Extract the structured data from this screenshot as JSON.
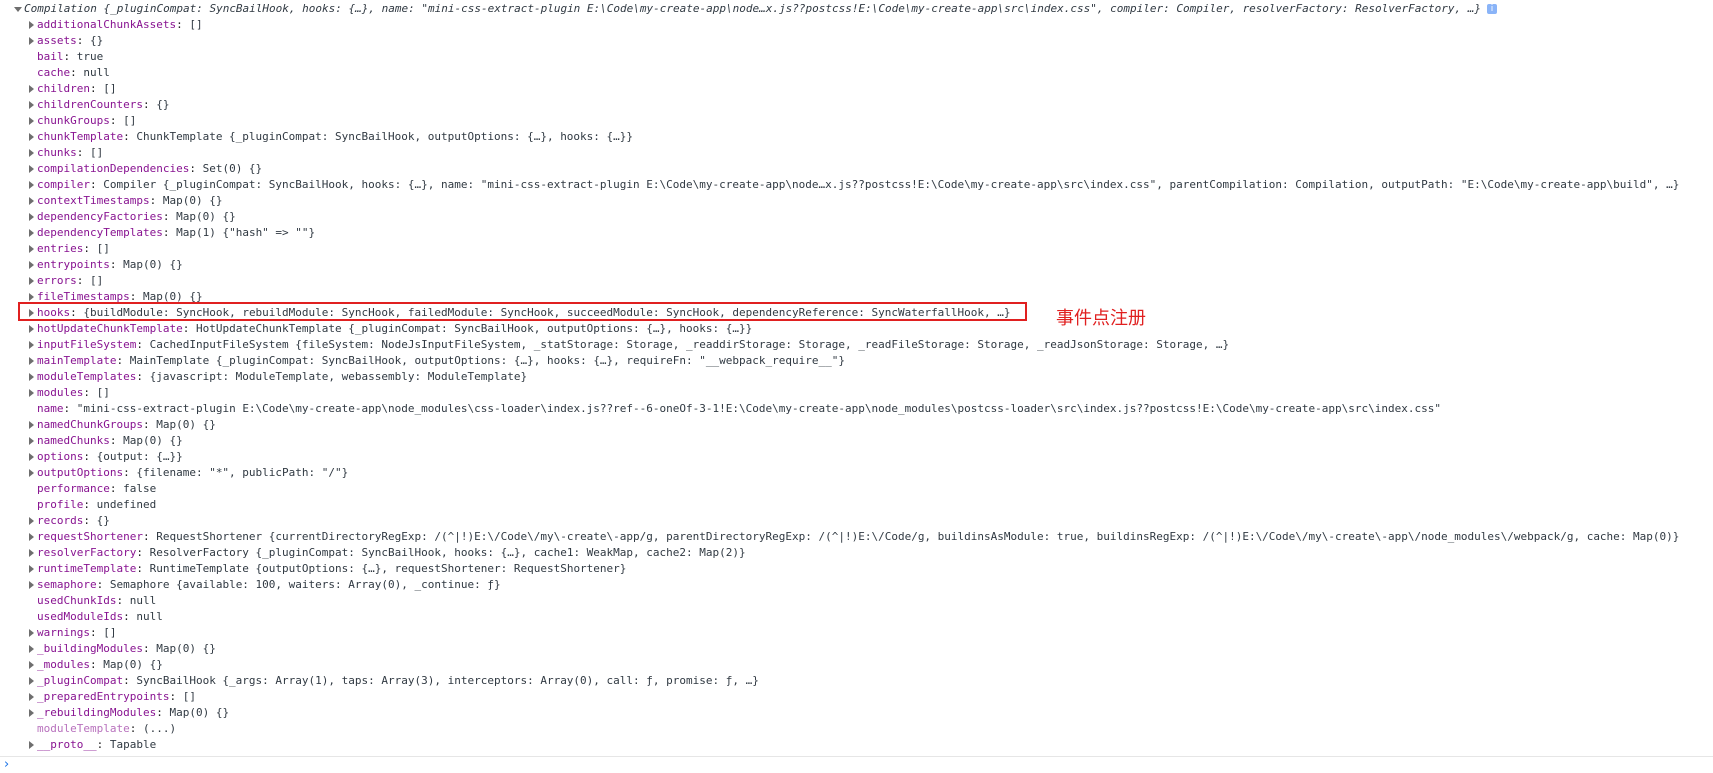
{
  "header": {
    "prefix": "Compilation",
    "summary": "{_pluginCompat: SyncBailHook, hooks: {…}, name: \"mini-css-extract-plugin E:\\Code\\my-create-app\\node…x.js??postcss!E:\\Code\\my-create-app\\src\\index.css\", compiler: Compiler, resolverFactory: ResolverFactory, …}",
    "info_icon": "i"
  },
  "properties": [
    {
      "key": "additionalChunkAssets",
      "value": "[]",
      "expandable": true
    },
    {
      "key": "assets",
      "value": "{}",
      "expandable": true
    },
    {
      "key": "bail",
      "value": "true",
      "expandable": false
    },
    {
      "key": "cache",
      "value": "null",
      "expandable": false
    },
    {
      "key": "children",
      "value": "[]",
      "expandable": true
    },
    {
      "key": "childrenCounters",
      "value": "{}",
      "expandable": true
    },
    {
      "key": "chunkGroups",
      "value": "[]",
      "expandable": true
    },
    {
      "key": "chunkTemplate",
      "value": "ChunkTemplate {_pluginCompat: SyncBailHook, outputOptions: {…}, hooks: {…}}",
      "expandable": true
    },
    {
      "key": "chunks",
      "value": "[]",
      "expandable": true
    },
    {
      "key": "compilationDependencies",
      "value": "Set(0) {}",
      "expandable": true
    },
    {
      "key": "compiler",
      "value": "Compiler {_pluginCompat: SyncBailHook, hooks: {…}, name: \"mini-css-extract-plugin E:\\Code\\my-create-app\\node…x.js??postcss!E:\\Code\\my-create-app\\src\\index.css\", parentCompilation: Compilation, outputPath: \"E:\\Code\\my-create-app\\build\", …}",
      "expandable": true
    },
    {
      "key": "contextTimestamps",
      "value": "Map(0) {}",
      "expandable": true
    },
    {
      "key": "dependencyFactories",
      "value": "Map(0) {}",
      "expandable": true
    },
    {
      "key": "dependencyTemplates",
      "value": "Map(1) {\"hash\" => \"\"}",
      "expandable": true
    },
    {
      "key": "entries",
      "value": "[]",
      "expandable": true
    },
    {
      "key": "entrypoints",
      "value": "Map(0) {}",
      "expandable": true
    },
    {
      "key": "errors",
      "value": "[]",
      "expandable": true
    },
    {
      "key": "fileTimestamps",
      "value": "Map(0) {}",
      "expandable": true
    },
    {
      "key": "hooks",
      "value": "{buildModule: SyncHook, rebuildModule: SyncHook, failedModule: SyncHook, succeedModule: SyncHook, dependencyReference: SyncWaterfallHook, …}",
      "expandable": true
    },
    {
      "key": "hotUpdateChunkTemplate",
      "value": "HotUpdateChunkTemplate {_pluginCompat: SyncBailHook, outputOptions: {…}, hooks: {…}}",
      "expandable": true
    },
    {
      "key": "inputFileSystem",
      "value": "CachedInputFileSystem {fileSystem: NodeJsInputFileSystem, _statStorage: Storage, _readdirStorage: Storage, _readFileStorage: Storage, _readJsonStorage: Storage, …}",
      "expandable": true
    },
    {
      "key": "mainTemplate",
      "value": "MainTemplate {_pluginCompat: SyncBailHook, outputOptions: {…}, hooks: {…}, requireFn: \"__webpack_require__\"}",
      "expandable": true
    },
    {
      "key": "moduleTemplates",
      "value": "{javascript: ModuleTemplate, webassembly: ModuleTemplate}",
      "expandable": true
    },
    {
      "key": "modules",
      "value": "[]",
      "expandable": true
    },
    {
      "key": "name",
      "value": "\"mini-css-extract-plugin E:\\Code\\my-create-app\\node_modules\\css-loader\\index.js??ref--6-oneOf-3-1!E:\\Code\\my-create-app\\node_modules\\postcss-loader\\src\\index.js??postcss!E:\\Code\\my-create-app\\src\\index.css\"",
      "expandable": false
    },
    {
      "key": "namedChunkGroups",
      "value": "Map(0) {}",
      "expandable": true
    },
    {
      "key": "namedChunks",
      "value": "Map(0) {}",
      "expandable": true
    },
    {
      "key": "options",
      "value": "{output: {…}}",
      "expandable": true
    },
    {
      "key": "outputOptions",
      "value": "{filename: \"*\", publicPath: \"/\"}",
      "expandable": true
    },
    {
      "key": "performance",
      "value": "false",
      "expandable": false
    },
    {
      "key": "profile",
      "value": "undefined",
      "expandable": false
    },
    {
      "key": "records",
      "value": "{}",
      "expandable": true
    },
    {
      "key": "requestShortener",
      "value": "RequestShortener {currentDirectoryRegExp: /(^|!)E:\\/Code\\/my\\-create\\-app/g, parentDirectoryRegExp: /(^|!)E:\\/Code/g, buildinsAsModule: true, buildinsRegExp: /(^|!)E:\\/Code\\/my\\-create\\-app\\/node_modules\\/webpack/g, cache: Map(0)}",
      "expandable": true
    },
    {
      "key": "resolverFactory",
      "value": "ResolverFactory {_pluginCompat: SyncBailHook, hooks: {…}, cache1: WeakMap, cache2: Map(2)}",
      "expandable": true
    },
    {
      "key": "runtimeTemplate",
      "value": "RuntimeTemplate {outputOptions: {…}, requestShortener: RequestShortener}",
      "expandable": true
    },
    {
      "key": "semaphore",
      "value": "Semaphore {available: 100, waiters: Array(0), _continue: ƒ}",
      "expandable": true
    },
    {
      "key": "usedChunkIds",
      "value": "null",
      "expandable": false
    },
    {
      "key": "usedModuleIds",
      "value": "null",
      "expandable": false
    },
    {
      "key": "warnings",
      "value": "[]",
      "expandable": true
    },
    {
      "key": "_buildingModules",
      "value": "Map(0) {}",
      "expandable": true
    },
    {
      "key": "_modules",
      "value": "Map(0) {}",
      "expandable": true
    },
    {
      "key": "_pluginCompat",
      "value": "SyncBailHook {_args: Array(1), taps: Array(3), interceptors: Array(0), call: ƒ, promise: ƒ, …}",
      "expandable": true
    },
    {
      "key": "_preparedEntrypoints",
      "value": "[]",
      "expandable": true
    },
    {
      "key": "_rebuildingModules",
      "value": "Map(0) {}",
      "expandable": true
    },
    {
      "key": "moduleTemplate",
      "value": "(...)",
      "expandable": false,
      "dim": true
    },
    {
      "key": "__proto__",
      "value": "Tapable",
      "expandable": true
    }
  ],
  "annotation": {
    "text": "事件点注册",
    "color": "#e02020",
    "target_key": "hooks"
  },
  "console_prompt": "›"
}
